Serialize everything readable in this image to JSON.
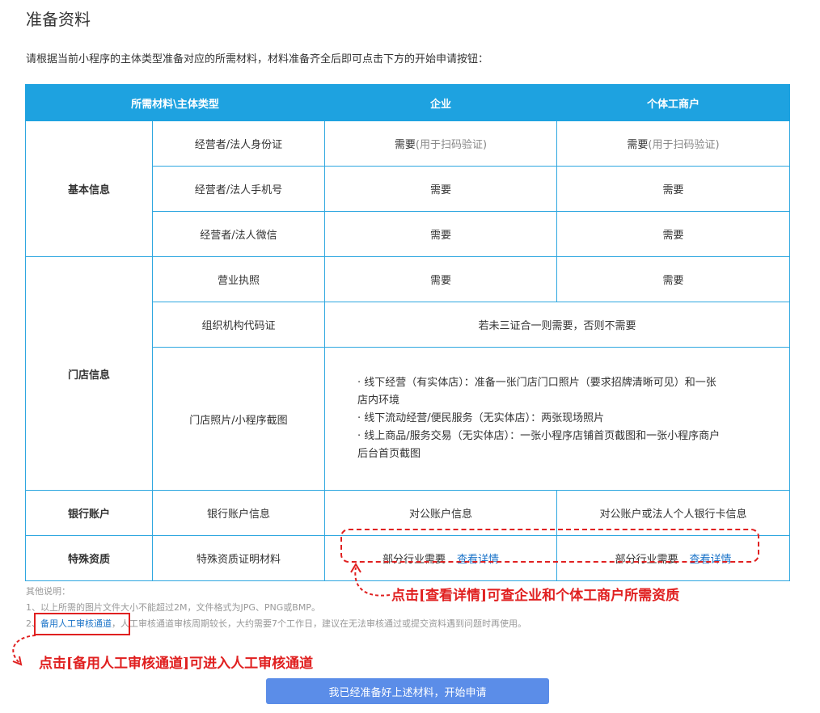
{
  "page": {
    "title": "准备资料",
    "intro": "请根据当前小程序的主体类型准备对应的所需材料，材料准备齐全后即可点击下方的开始申请按钮："
  },
  "table": {
    "headers": {
      "material": "所需材料\\主体类型",
      "enterprise": "企业",
      "individual": "个体工商户"
    },
    "basic": {
      "group": "基本信息",
      "rows": [
        {
          "item": "经营者/法人身份证",
          "enterprise": "需要",
          "enterprise_note": "(用于扫码验证)",
          "individual": "需要",
          "individual_note": "(用于扫码验证)"
        },
        {
          "item": "经营者/法人手机号",
          "enterprise": "需要",
          "individual": "需要"
        },
        {
          "item": "经营者/法人微信",
          "enterprise": "需要",
          "individual": "需要"
        }
      ]
    },
    "store": {
      "group": "门店信息",
      "license": {
        "item": "营业执照",
        "enterprise": "需要",
        "individual": "需要"
      },
      "org_code": {
        "item": "组织机构代码证",
        "value": "若未三证合一则需要，否则不需要"
      },
      "photos": {
        "item": "门店照片/小程序截图",
        "lines": [
          "· 线下经营（有实体店）：准备一张门店门口照片（要求招牌清晰可见）和一张",
          "店内环境",
          "· 线下流动经营/便民服务（无实体店）：两张现场照片",
          "· 线上商品/服务交易（无实体店）：一张小程序店铺首页截图和一张小程序商户",
          "后台首页截图"
        ]
      }
    },
    "bank": {
      "group": "银行账户",
      "item": "银行账户信息",
      "enterprise": "对公账户信息",
      "individual": "对公账户或法人个人银行卡信息"
    },
    "special": {
      "group": "特殊资质",
      "item": "特殊资质证明材料",
      "enterprise": "部分行业需要",
      "individual": "部分行业需要",
      "link": "查看详情"
    }
  },
  "notes": {
    "heading": "其他说明：",
    "line1": "1、以上所需的图片文件大小不能超过2M，文件格式为JPG、PNG或BMP。",
    "line2_prefix": "2、",
    "line2_link": "备用人工审核通道",
    "line2_rest": "，人工审核通道审核周期较长，大约需要7个工作日，建议在无法审核通过或提交资料遇到问题时再使用。"
  },
  "annotations": {
    "details": "点击[查看详情]可查企业和个体工商户所需资质",
    "manual": "点击[备用人工审核通道]可进入人工审核通道"
  },
  "actions": {
    "start": "我已经准备好上述材料，开始申请"
  },
  "colors": {
    "header_bg": "#1ea2e0",
    "annotation_red": "#e02020",
    "link_blue": "#1a73c8",
    "button_bg": "#5b8de8"
  }
}
